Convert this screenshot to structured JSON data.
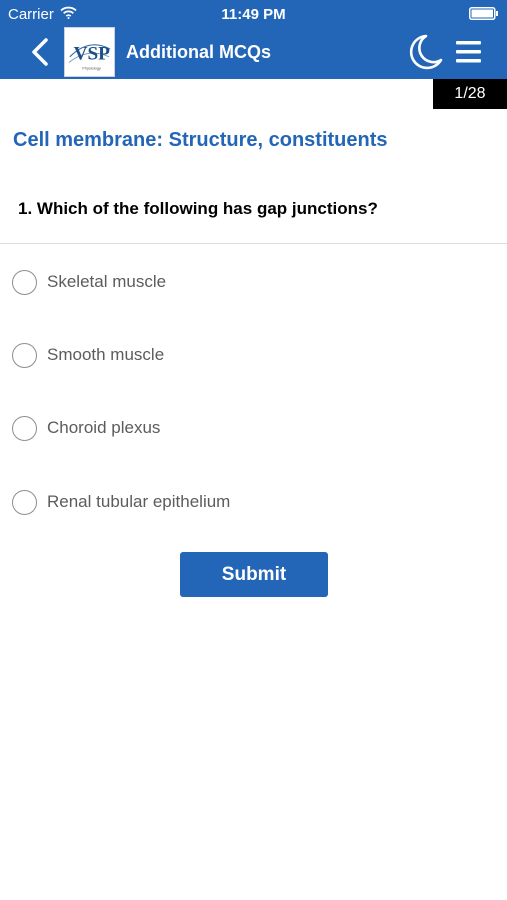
{
  "status_bar": {
    "carrier": "Carrier",
    "time": "11:49 PM"
  },
  "header": {
    "title": "Additional MCQs",
    "logo_text": "VSP",
    "logo_subtext": "Physiology"
  },
  "counter": "1/28",
  "section_title": "Cell membrane: Structure, constituents",
  "question": "1. Which of the following has gap junctions?",
  "options": [
    {
      "label": "Skeletal muscle"
    },
    {
      "label": "Smooth muscle"
    },
    {
      "label": "Choroid plexus"
    },
    {
      "label": "Renal tubular epithelium"
    }
  ],
  "submit_label": "Submit",
  "colors": {
    "brand": "#2366b7",
    "counter_bg": "#000000"
  }
}
